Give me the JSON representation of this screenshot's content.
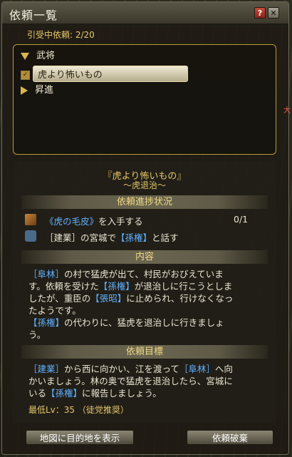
{
  "window": {
    "title": "依頼一覧"
  },
  "titlebar": {
    "help_label": "?",
    "close_label": "✕"
  },
  "list": {
    "count_text": "引受中依頼: 2/20",
    "categories": [
      {
        "label": "武将",
        "expanded": true
      },
      {
        "label": "昇進",
        "expanded": false
      }
    ],
    "selected_item": {
      "label": "虎より怖いもの",
      "checked": true,
      "check_glyph": "✓"
    }
  },
  "detail": {
    "quest_title": "『虎より怖いもの』",
    "quest_subtitle": "〜虎退治〜",
    "sections": {
      "progress": "依頼進捗状況",
      "content": "内容",
      "goal": "依頼目標"
    },
    "objectives": [
      {
        "pre": "",
        "name": "《虎の毛皮》",
        "post": "を入手する",
        "progress": "0/1",
        "icon": "tiger-pelt-icon"
      },
      {
        "pre": "［建業］の宮城で",
        "name": "【孫権】",
        "post": "と話す",
        "progress": "",
        "icon": "person-icon"
      }
    ],
    "content_lines": [
      [
        {
          "t": "［阜林］",
          "c": "blue"
        },
        {
          "t": "の村で猛虎が出て、村民がおびえていま",
          "c": ""
        }
      ],
      [
        {
          "t": "す。依頼を受けた",
          "c": ""
        },
        {
          "t": "【孫権】",
          "c": "blue"
        },
        {
          "t": "が退治しに行こうとしま",
          "c": ""
        }
      ],
      [
        {
          "t": "したが、重臣の",
          "c": ""
        },
        {
          "t": "【張昭】",
          "c": "blue"
        },
        {
          "t": "に止められ、行けなくなっ",
          "c": ""
        }
      ],
      [
        {
          "t": "たようです。",
          "c": ""
        }
      ],
      [
        {
          "t": "【孫権】",
          "c": "blue"
        },
        {
          "t": "の代わりに、猛虎を退治しに行きましょ",
          "c": ""
        }
      ],
      [
        {
          "t": "う。",
          "c": ""
        }
      ]
    ],
    "goal_lines": [
      [
        {
          "t": "［建業］",
          "c": "blue"
        },
        {
          "t": "から西に向かい、江を渡って",
          "c": ""
        },
        {
          "t": "［阜林］",
          "c": "blue"
        },
        {
          "t": "へ向",
          "c": ""
        }
      ],
      [
        {
          "t": "かいましょう。林の奥で猛虎を退治したら、宮城に",
          "c": ""
        }
      ],
      [
        {
          "t": "いる",
          "c": ""
        },
        {
          "t": "【孫権】",
          "c": "blue"
        },
        {
          "t": "に報告しましょう。",
          "c": ""
        }
      ]
    ],
    "min_level": "最低Lv：35 （徒党推奨）"
  },
  "buttons": {
    "show_map": "地図に目的地を表示",
    "abandon": "依頼破棄"
  },
  "side_text": "大",
  "colors": {
    "accent_gold": "#e4c76a",
    "link_blue": "#5fb0ff",
    "frame_gold": "#b99b37"
  }
}
